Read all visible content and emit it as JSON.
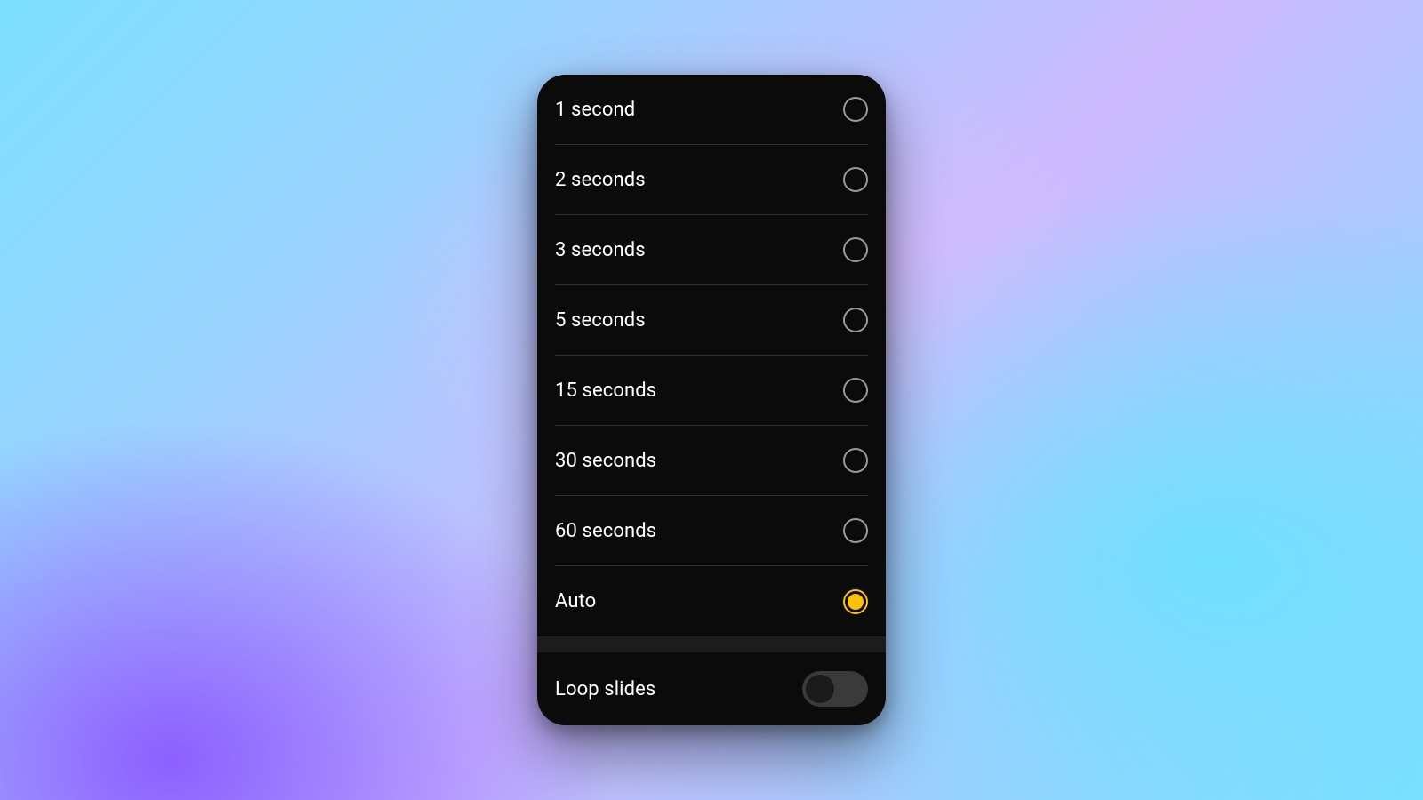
{
  "options": [
    {
      "label": "1 second",
      "selected": false
    },
    {
      "label": "2 seconds",
      "selected": false
    },
    {
      "label": "3 seconds",
      "selected": false
    },
    {
      "label": "5 seconds",
      "selected": false
    },
    {
      "label": "15 seconds",
      "selected": false
    },
    {
      "label": "30 seconds",
      "selected": false
    },
    {
      "label": "60 seconds",
      "selected": false
    },
    {
      "label": "Auto",
      "selected": true
    }
  ],
  "loop": {
    "label": "Loop slides",
    "on": false
  },
  "colors": {
    "accent": "#ffc107"
  }
}
